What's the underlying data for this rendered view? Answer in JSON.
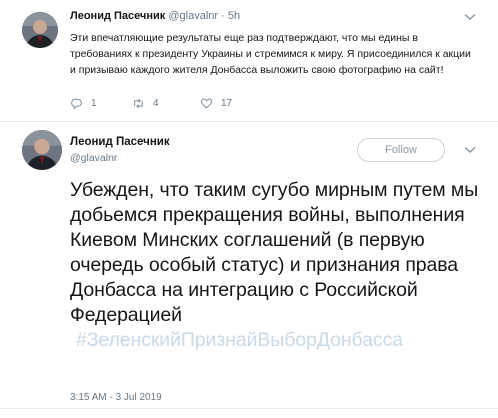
{
  "tweet1": {
    "author_name": "Леонид Пасечник",
    "author_handle": "@glavalnr",
    "separator": "·",
    "time": "5h",
    "text": "Эти впечатляющие результаты еще раз подтверждают, что мы едины в требованиях к президенту Украины и стремимся к миру. Я присоединился к акции и призываю каждого жителя Донбасса выложить свою фотографию на сайт!",
    "replies": "1",
    "retweets": "4",
    "likes": "17"
  },
  "tweet2": {
    "author_name": "Леонид Пасечник",
    "author_handle": "@glavalnr",
    "follow_label": "Follow",
    "text": "Убежден, что таким сугубо мирным путем мы добьемся прекращения войны, выполнения Киевом Минских соглашений (в первую очередь особый статус) и признания права Донбасса на интеграцию с Российской Федерацией",
    "hashtag": "#ЗеленскийПризнайВыборДонбасса",
    "timestamp": "3:15 AM - 3 Jul 2019"
  },
  "colors": {
    "link": "#c8d9e8",
    "secondary_text": "#657786",
    "follow_border": "#c8d3dc"
  }
}
